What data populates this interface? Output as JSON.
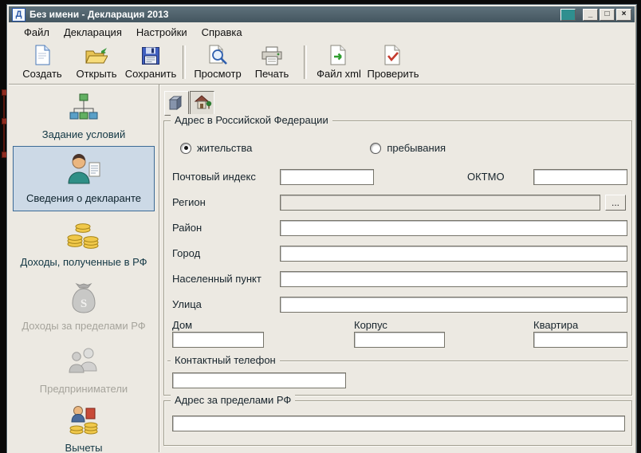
{
  "window": {
    "title": "Без имени - Декларация 2013",
    "icon_letter": "Д",
    "controls": {
      "minimize": "_",
      "maximize": "□",
      "close": "×"
    }
  },
  "menu": {
    "items": [
      {
        "label": "Файл"
      },
      {
        "label": "Декларация"
      },
      {
        "label": "Настройки"
      },
      {
        "label": "Справка"
      }
    ]
  },
  "toolbar": {
    "buttons": [
      {
        "label": "Создать",
        "icon": "new-document-icon"
      },
      {
        "label": "Открыть",
        "icon": "open-folder-icon"
      },
      {
        "label": "Сохранить",
        "icon": "save-icon"
      },
      {
        "label": "Просмотр",
        "icon": "preview-icon"
      },
      {
        "label": "Печать",
        "icon": "print-icon"
      },
      {
        "label": "Файл xml",
        "icon": "xml-file-icon"
      },
      {
        "label": "Проверить",
        "icon": "check-document-icon"
      }
    ]
  },
  "sidebar": {
    "items": [
      {
        "label": "Задание условий",
        "state": "normal",
        "icon": "conditions-flowchart-icon"
      },
      {
        "label": "Сведения о декларанте",
        "state": "selected",
        "icon": "declarant-person-icon"
      },
      {
        "label": "Доходы, полученные в РФ",
        "state": "normal",
        "icon": "coins-icon"
      },
      {
        "label": "Доходы за пределами РФ",
        "state": "disabled",
        "icon": "money-bag-icon"
      },
      {
        "label": "Предприниматели",
        "state": "disabled",
        "icon": "entrepreneurs-icon"
      },
      {
        "label": "Вычеты",
        "state": "normal",
        "icon": "deductions-icon"
      }
    ]
  },
  "content": {
    "view_tabs": [
      {
        "icon": "buildings-3d-icon",
        "active": false
      },
      {
        "icon": "home-icon",
        "active": true
      }
    ],
    "address_rf": {
      "title": "Адрес в Российской Федерации",
      "radio_options": [
        {
          "label": "жительства",
          "checked": true
        },
        {
          "label": "пребывания",
          "checked": false
        }
      ],
      "fields": {
        "postal_index": {
          "label": "Почтовый индекс",
          "value": ""
        },
        "oktmo": {
          "label": "ОКТМО",
          "value": ""
        },
        "region": {
          "label": "Регион",
          "value": "",
          "browse_label": "..."
        },
        "district": {
          "label": "Район",
          "value": ""
        },
        "city": {
          "label": "Город",
          "value": ""
        },
        "settlement": {
          "label": "Населенный пункт",
          "value": ""
        },
        "street": {
          "label": "Улица",
          "value": ""
        },
        "house": {
          "label": "Дом",
          "value": ""
        },
        "building": {
          "label": "Корпус",
          "value": ""
        },
        "apartment": {
          "label": "Квартира",
          "value": ""
        }
      },
      "phone_group": {
        "title": "Контактный телефон",
        "value": ""
      }
    },
    "address_foreign": {
      "title": "Адрес за пределами РФ",
      "value": ""
    }
  }
}
